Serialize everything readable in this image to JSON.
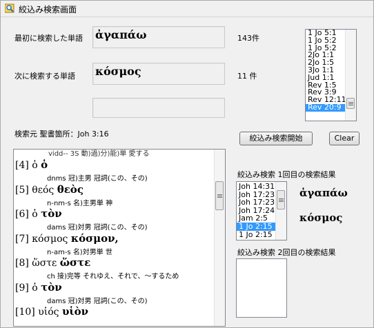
{
  "window": {
    "title": "絞込み検索画面"
  },
  "first_search": {
    "label": "最初に検索した単語",
    "word": "ἀγαπάω",
    "count": "143件"
  },
  "second_search": {
    "label": "次に検索する単語",
    "word": "κόσμος",
    "count": "11 件"
  },
  "third_field": {
    "value": ""
  },
  "source": {
    "label": "検索元  聖書箇所：Joh 3:16"
  },
  "first_results": {
    "items": [
      "1 Jo 5:1",
      "1 Jo 5:2",
      "1 Jo 5:2",
      "2Jo 1:1",
      "2Jo 1:5",
      "3Jo 1:1",
      "Jud 1:1",
      "Rev 1:5",
      "Rev 3:9",
      "Rev 12:11",
      "Rev 20:9"
    ],
    "selected_index": 10
  },
  "buttons": {
    "start": "絞込み検索開始",
    "clear": "Clear"
  },
  "result1": {
    "heading": "絞込み検索  1回目の検索結果",
    "items": [
      "Joh 14:31",
      "Joh 17:23",
      "Joh 17:23",
      "Joh 17:24",
      "Jam 2:5",
      "1 Jo 2:15",
      "1 Jo 2:15"
    ],
    "selected_index": 5,
    "word1": "ἀγαπάω",
    "word2": "κόσμος"
  },
  "result2": {
    "heading": "絞込み検索  2回目の検索結果",
    "items": []
  },
  "text_panel": {
    "partial_top": "vidd-- 3S 動)過)分)能)単 愛する",
    "entries": [
      {
        "index": "[4]",
        "lemma": "ὁ",
        "form": "ὁ",
        "gloss": "dnms 冠)主男 冠詞(この、その)"
      },
      {
        "index": "[5]",
        "lemma": "θεός",
        "form": "θεὸς",
        "gloss": "n-nm-s 名)主男単 神"
      },
      {
        "index": "[6]",
        "lemma": "ὁ",
        "form": "τὸν",
        "gloss": "dams 冠)対男 冠詞(この、その)"
      },
      {
        "index": "[7]",
        "lemma": "κόσμος",
        "form": "κόσμον,",
        "gloss": "n-am-s 名)対男単 世"
      },
      {
        "index": "[8]",
        "lemma": "ὥστε",
        "form": "ὥστε",
        "gloss": "ch 接)完等 それゆえ、それで、～するため"
      },
      {
        "index": "[9]",
        "lemma": "ὁ",
        "form": "τὸν",
        "gloss": "dams 冠)対男 冠詞(この、その)"
      },
      {
        "index": "[10]",
        "lemma": "υἱός",
        "form": "υἱὸν",
        "gloss": ""
      }
    ]
  },
  "colors": {
    "selection": "#3399ff",
    "panel_bg": "#f0f0f0"
  }
}
